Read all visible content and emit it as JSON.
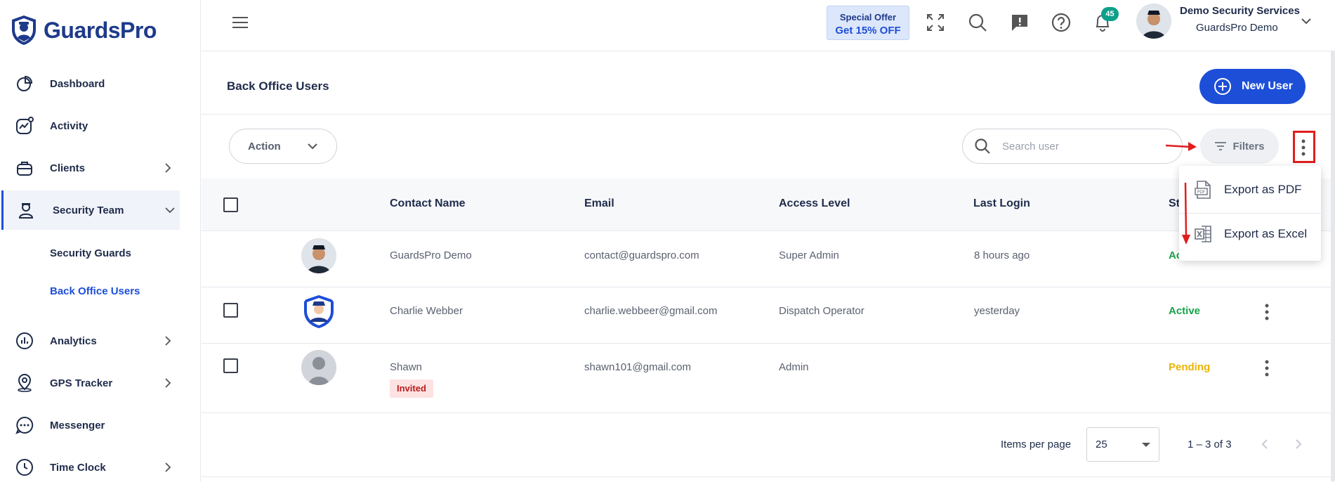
{
  "brand": {
    "name": "GuardsPro"
  },
  "sidebar": {
    "items": [
      {
        "label": "Dashboard",
        "icon": "dashboard-icon"
      },
      {
        "label": "Activity",
        "icon": "activity-icon"
      },
      {
        "label": "Clients",
        "icon": "clients-icon"
      },
      {
        "label": "Security Team",
        "icon": "security-team-icon"
      },
      {
        "label": "Analytics",
        "icon": "analytics-icon"
      },
      {
        "label": "GPS Tracker",
        "icon": "gps-tracker-icon"
      },
      {
        "label": "Messenger",
        "icon": "messenger-icon"
      },
      {
        "label": "Time Clock",
        "icon": "time-clock-icon"
      }
    ],
    "sub_items": [
      {
        "label": "Security Guards"
      },
      {
        "label": "Back Office Users"
      }
    ]
  },
  "header": {
    "offer_line1": "Special Offer",
    "offer_line2": "Get 15% OFF",
    "notification_count": "45",
    "user_name": "Demo Security Services",
    "user_company": "GuardsPro Demo"
  },
  "page": {
    "title": "Back Office Users",
    "new_user_label": "New User"
  },
  "toolbar": {
    "action_label": "Action",
    "search_placeholder": "Search user",
    "filters_label": "Filters"
  },
  "export_menu": {
    "pdf_label": "Export as PDF",
    "excel_label": "Export as Excel"
  },
  "table": {
    "columns": [
      "Contact Name",
      "Email",
      "Access Level",
      "Last Login",
      "St"
    ],
    "rows": [
      {
        "name": "GuardsPro Demo",
        "email": "contact@guardspro.com",
        "access": "Super Admin",
        "last_login": "8 hours ago",
        "status": "Ac"
      },
      {
        "name": "Charlie Webber",
        "email": "charlie.webbeer@gmail.com",
        "access": "Dispatch Operator",
        "last_login": "yesterday",
        "status": "Active"
      },
      {
        "name": "Shawn",
        "email": "shawn101@gmail.com",
        "access": "Admin",
        "last_login": "",
        "status": "Pending",
        "tag": "Invited"
      }
    ]
  },
  "pagination": {
    "items_per_page_label": "Items per page",
    "items_per_page_value": "25",
    "range": "1 – 3 of 3"
  },
  "colors": {
    "brand_blue": "#1d4ed8",
    "active_green": "#16a34a",
    "pending_yellow": "#eab308",
    "annotation_red": "#e11d1d"
  }
}
